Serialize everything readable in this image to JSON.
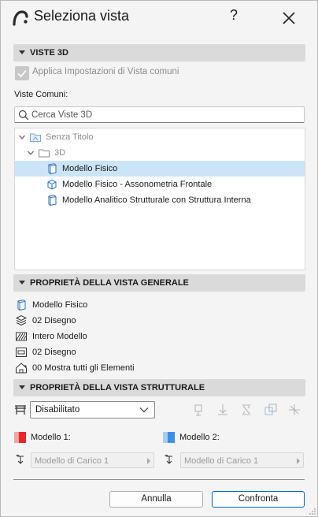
{
  "window": {
    "title": "Seleziona vista",
    "help": "?"
  },
  "section_3d": {
    "label": "VISTE 3D"
  },
  "apply_checkbox": {
    "label": "Applica Impostazioni di Vista comuni",
    "checked": true,
    "disabled": true
  },
  "common_views_label": "Viste Comuni:",
  "search": {
    "placeholder": "Cerca Viste 3D",
    "value": ""
  },
  "tree": {
    "root": {
      "label": "Senza Titolo"
    },
    "folder": {
      "label": "3D"
    },
    "items": [
      {
        "label": "Modello Fisico",
        "selected": true
      },
      {
        "label": "Modello Fisico - Assonometria Frontale",
        "selected": false
      },
      {
        "label": "Modello Analitico Strutturale con Struttura Interna",
        "selected": false
      }
    ]
  },
  "section_general": {
    "label": "PROPRIETÀ DELLA VISTA GENERALE"
  },
  "general_props": [
    {
      "icon": "model-view-icon",
      "value": "Modello Fisico"
    },
    {
      "icon": "layer-combination-icon",
      "value": "02 Disegno"
    },
    {
      "icon": "partial-structure-icon",
      "value": "Intero Modello"
    },
    {
      "icon": "graphic-override-icon",
      "value": "02 Disegno"
    },
    {
      "icon": "renovation-filter-icon",
      "value": "00 Mostra tutti gli Elementi"
    }
  ],
  "section_structural": {
    "label": "PROPRIETÀ DELLA VISTA STRUTTURALE"
  },
  "structural": {
    "mode": "Disabilitato",
    "model1": {
      "label": "Modello 1:",
      "color": "#e8262b",
      "load": "Modello di Carico 1"
    },
    "model2": {
      "label": "Modello 2:",
      "color": "#3d8ee8",
      "load": "Modello di Carico 1"
    }
  },
  "buttons": {
    "cancel": "Annulla",
    "compare": "Confronta"
  },
  "colors": {
    "selection": "#cce4f7",
    "primary_border": "#0067c0",
    "section_bg": "#dadada"
  }
}
